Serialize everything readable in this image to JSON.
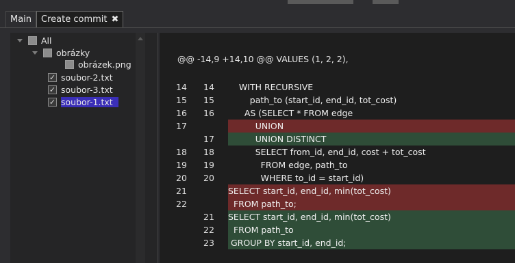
{
  "tabs": [
    {
      "label": "Main",
      "active": false
    },
    {
      "label": "Create commit",
      "active": true,
      "close_icon": "close-x-icon"
    }
  ],
  "tree": {
    "items": [
      {
        "label": "All",
        "state": "indeterminate",
        "expander": true
      },
      {
        "label": "obrázky",
        "state": "indeterminate",
        "expander": true
      },
      {
        "label": "obrázek.png",
        "state": "indeterminate",
        "expander": false
      },
      {
        "label": "soubor-2.txt",
        "state": "checked",
        "expander": false
      },
      {
        "label": "soubor-3.txt",
        "state": "checked",
        "expander": false
      },
      {
        "label": "soubor-1.txt",
        "state": "checked",
        "expander": false,
        "selected": true
      }
    ]
  },
  "diff": {
    "hunk_header": "@@ -14,9 +14,10 @@ VALUES (1, 2, 2),",
    "lines": [
      {
        "old": "14",
        "new": "14",
        "type": "ctx",
        "text": "    WITH RECURSIVE"
      },
      {
        "old": "15",
        "new": "15",
        "type": "ctx",
        "text": "        path_to (start_id, end_id, tot_cost)"
      },
      {
        "old": "16",
        "new": "16",
        "type": "ctx",
        "text": "      AS (SELECT * FROM edge"
      },
      {
        "old": "17",
        "new": "",
        "type": "del",
        "text": "          UNION"
      },
      {
        "old": "",
        "new": "17",
        "type": "add",
        "text": "          UNION DISTINCT"
      },
      {
        "old": "18",
        "new": "18",
        "type": "ctx",
        "text": "          SELECT from_id, end_id, cost + tot_cost"
      },
      {
        "old": "19",
        "new": "19",
        "type": "ctx",
        "text": "            FROM edge, path_to"
      },
      {
        "old": "20",
        "new": "20",
        "type": "ctx",
        "text": "            WHERE to_id = start_id)"
      },
      {
        "old": "21",
        "new": "",
        "type": "del",
        "text": "SELECT start_id, end_id, min(tot_cost)"
      },
      {
        "old": "22",
        "new": "",
        "type": "del",
        "text": "  FROM path_to;"
      },
      {
        "old": "",
        "new": "21",
        "type": "add",
        "text": "SELECT start_id, end_id, min(tot_cost)"
      },
      {
        "old": "",
        "new": "22",
        "type": "add",
        "text": "  FROM path_to"
      },
      {
        "old": "",
        "new": "23",
        "type": "add",
        "text": " GROUP BY start_id, end_id;"
      }
    ]
  }
}
